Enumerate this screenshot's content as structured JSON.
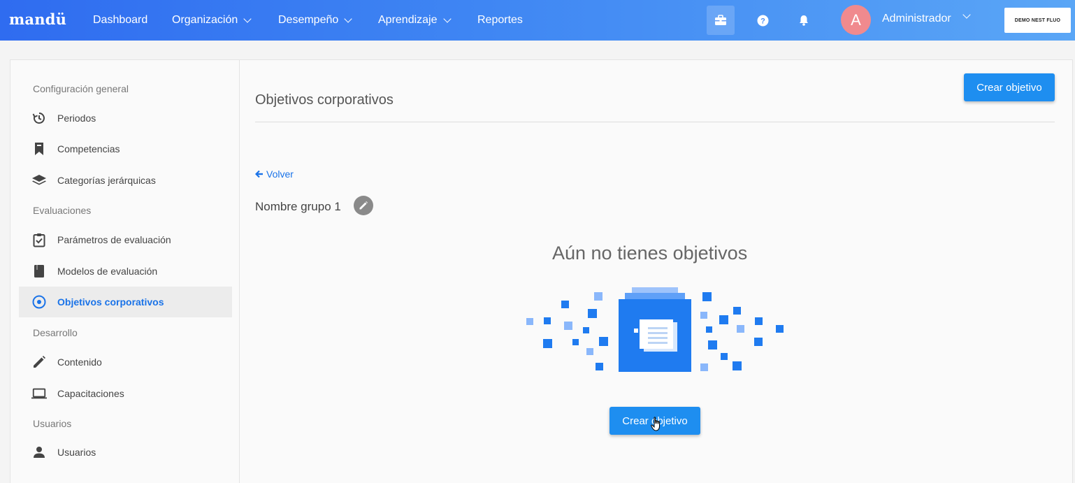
{
  "brand": {
    "logo": "mandü",
    "company_badge": "DEMO NEST FLUO"
  },
  "nav": [
    {
      "label": "Dashboard",
      "has_dropdown": false
    },
    {
      "label": "Organización",
      "has_dropdown": true
    },
    {
      "label": "Desempeño",
      "has_dropdown": true
    },
    {
      "label": "Aprendizaje",
      "has_dropdown": true
    },
    {
      "label": "Reportes",
      "has_dropdown": false
    }
  ],
  "topbar_icons": [
    "briefcase-icon",
    "help-icon",
    "bell-icon"
  ],
  "user": {
    "avatar_initial": "A",
    "name": "Administrador"
  },
  "sidebar": {
    "sections": [
      {
        "title": "Configuración general",
        "items": [
          {
            "label": "Periodos",
            "icon": "history-icon"
          },
          {
            "label": "Competencias",
            "icon": "bookmark-icon"
          },
          {
            "label": "Categorías jerárquicas",
            "icon": "layers-icon"
          }
        ]
      },
      {
        "title": "Evaluaciones",
        "items": [
          {
            "label": "Parámetros de evaluación",
            "icon": "clipboard-check-icon"
          },
          {
            "label": "Modelos de evaluación",
            "icon": "book-icon"
          },
          {
            "label": "Objetivos corporativos",
            "icon": "target-icon",
            "active": true
          }
        ]
      },
      {
        "title": "Desarrollo",
        "items": [
          {
            "label": "Contenido",
            "icon": "pencil-icon"
          },
          {
            "label": "Capacitaciones",
            "icon": "laptop-icon"
          }
        ]
      },
      {
        "title": "Usuarios",
        "items": [
          {
            "label": "Usuarios",
            "icon": "user-icon"
          }
        ]
      }
    ]
  },
  "main": {
    "title": "Objetivos corporativos",
    "create_button": "Crear objetivo",
    "back_link": "Volver",
    "group_name": "Nombre grupo 1",
    "empty_state": {
      "title": "Aún no tienes objetivos",
      "button": "Crear objetivo"
    }
  },
  "colors": {
    "accent": "#1e8ef0",
    "nav_start": "#2f6cf0",
    "nav_end": "#5aa6f6",
    "active_text": "#1a73e8",
    "avatar": "#f08a8e"
  }
}
